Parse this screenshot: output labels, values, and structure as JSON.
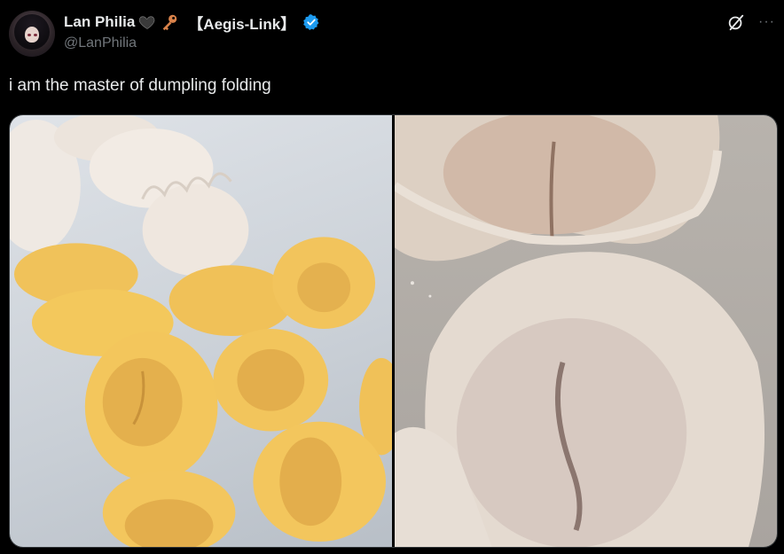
{
  "author": {
    "display_name": "Lan Philia",
    "tag": "【Aegis-Link】",
    "handle": "@LanPhilia",
    "avatar_icon": "avatar-image",
    "emoji": [
      "black-heart-icon",
      "key-icon"
    ],
    "verified_color": "#1d9bf0"
  },
  "tweet": {
    "text": "i am the master of dumpling folding"
  },
  "actions": {
    "grok_icon": "grok-icon",
    "more_icon": "more-icon",
    "more_label": "···"
  },
  "media": {
    "images": [
      "dumplings-photo",
      "dough-photo"
    ]
  }
}
